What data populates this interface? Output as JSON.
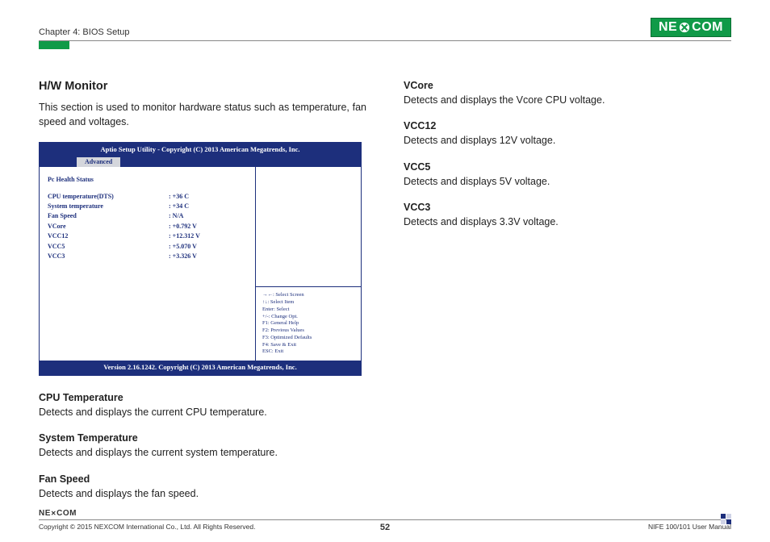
{
  "header": {
    "chapter": "Chapter 4: BIOS Setup",
    "logo_left": "NE",
    "logo_right": "COM"
  },
  "left": {
    "title": "H/W Monitor",
    "intro": "This section is used to monitor hardware status such as temperature, fan speed and voltages.",
    "bios": {
      "title": "Aptio Setup Utility - Copyright (C) 2013 American Megatrends, Inc.",
      "tab": "Advanced",
      "section": "Pc Health Status",
      "rows": [
        {
          "label": "CPU temperature(DTS)",
          "value": ":  +36 C"
        },
        {
          "label": "System temperature",
          "value": ":  +34 C"
        },
        {
          "label": "Fan Speed",
          "value": ":  N/A"
        },
        {
          "label": "VCore",
          "value": ":  +0.792 V"
        },
        {
          "label": "VCC12",
          "value": ":  +12.312 V"
        },
        {
          "label": "VCC5",
          "value": ":  +5.070 V"
        },
        {
          "label": "VCC3",
          "value": ":  +3.326 V"
        }
      ],
      "help": [
        "→←: Select Screen",
        "↑↓: Select Item",
        "Enter: Select",
        "+/-: Change Opt.",
        "F1: General Help",
        "F2: Previous Values",
        "F3: Optimized Defaults",
        "F4: Save & Exit",
        "ESC: Exit"
      ],
      "footer": "Version 2.16.1242. Copyright (C) 2013 American Megatrends, Inc."
    },
    "terms": [
      {
        "t": "CPU Temperature",
        "d": "Detects and displays the current CPU temperature."
      },
      {
        "t": "System Temperature",
        "d": "Detects and displays the current system temperature."
      },
      {
        "t": "Fan Speed",
        "d": "Detects and displays the fan speed."
      }
    ]
  },
  "right": {
    "terms": [
      {
        "t": "VCore",
        "d": "Detects and displays the Vcore CPU voltage."
      },
      {
        "t": "VCC12",
        "d": "Detects and displays 12V voltage."
      },
      {
        "t": "VCC5",
        "d": "Detects and displays 5V voltage."
      },
      {
        "t": "VCC3",
        "d": "Detects and displays 3.3V voltage."
      }
    ]
  },
  "footer": {
    "logo_left": "NE",
    "logo_right": "COM",
    "copyright": "Copyright © 2015 NEXCOM International Co., Ltd. All Rights Reserved.",
    "page": "52",
    "manual": "NIFE 100/101 User Manual"
  }
}
